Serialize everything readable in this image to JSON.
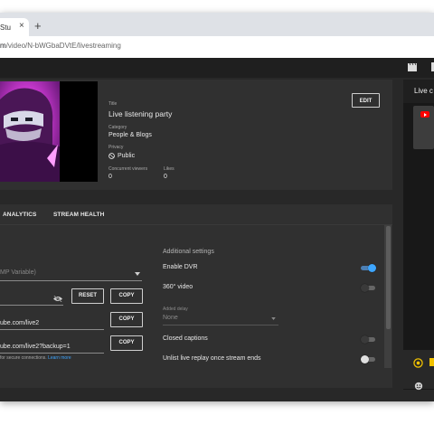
{
  "browser": {
    "tab_title": "Stu",
    "tab_close": "×",
    "new_tab": "+",
    "url_host": "m",
    "url_path": "/video/N-bWGbaDVtE/livestreaming"
  },
  "stream": {
    "title_label": "Title",
    "title_value": "Live listening party",
    "category_label": "Category",
    "category_value": "People & Blogs",
    "privacy_label": "Privacy",
    "privacy_value": "Public",
    "viewers_label": "Concurrent viewers",
    "viewers_value": "0",
    "likes_label": "Likes",
    "likes_value": "0",
    "edit_label": "EDIT"
  },
  "tabs": [
    "ANALYTICS",
    "STREAM HEALTH"
  ],
  "stream_settings": {
    "stream_key_select": "MP Variable)",
    "reset_label": "RESET",
    "copy_label": "COPY",
    "stream_url": "ube.com/live2",
    "backup_url": "ube.com/live2?backup=1",
    "helper_text": "for secure connections.",
    "helper_link": "Learn more"
  },
  "additional": {
    "heading": "Additional settings",
    "enable_dvr": "Enable DVR",
    "video_360": "360° video",
    "delay_label": "Added delay",
    "delay_value": "None",
    "closed_captions": "Closed captions",
    "unlist_replay": "Unlist live replay once stream ends",
    "toggles": {
      "enable_dvr": true,
      "video_360": false,
      "closed_captions": false,
      "unlist_replay": false
    }
  },
  "chat": {
    "title": "Live c"
  },
  "colors": {
    "accent": "#3ea6ff",
    "panel": "#303030",
    "background": "#282828",
    "youtube_red": "#ff0000"
  }
}
